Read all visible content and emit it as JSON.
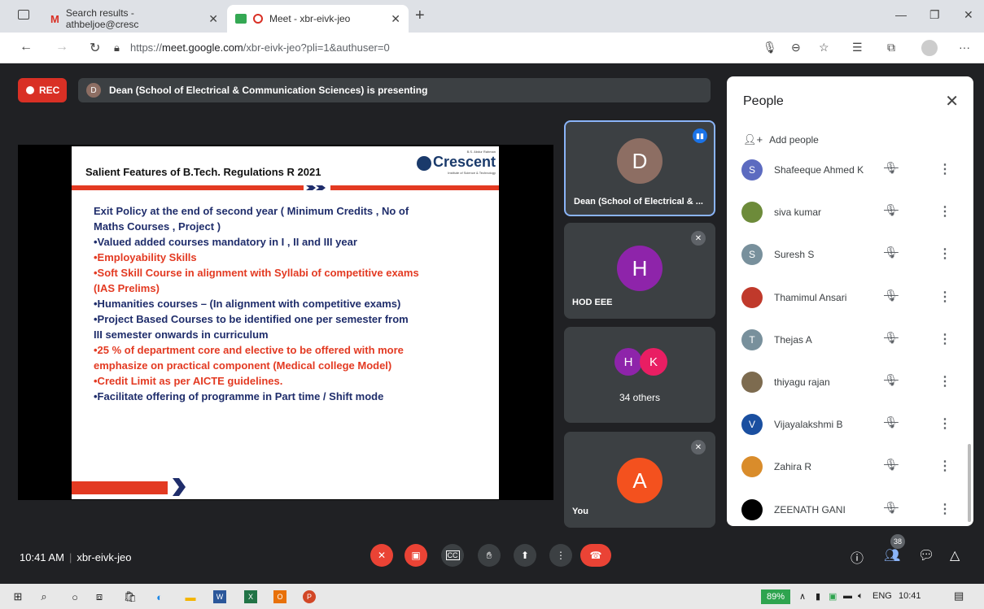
{
  "browser": {
    "tabs": [
      {
        "label": "Search results - athbeljoe@cresc",
        "icon": "gmail-icon"
      },
      {
        "label": "Meet - xbr-eivk-jeo",
        "icon": "meet-icon"
      }
    ],
    "url_prefix": "https://",
    "url_host": "meet.google.com",
    "url_path": "/xbr-eivk-jeo?pli=1&authuser=0"
  },
  "meet": {
    "rec_label": "REC",
    "presenting_avatar": "D",
    "presenting_text": "Dean (School of Electrical & Communication Sciences) is presenting",
    "meeting_time": "10:41 AM",
    "meeting_code": "xbr-eivk-jeo"
  },
  "slide": {
    "title": "Salient Features of B.Tech. Regulations R 2021",
    "logo_name": "Crescent",
    "logo_top": "B.S. Abdur Rahman",
    "logo_sub": "Institute of Science & Technology",
    "lines": [
      {
        "text": "Exit Policy at the end of second year ( Minimum Credits , No of",
        "color": "blue"
      },
      {
        "text": "Maths Courses , Project )",
        "color": "blue"
      },
      {
        "text": "•Valued added courses mandatory in I , II and III year",
        "color": "blue"
      },
      {
        "text": "•Employability Skills",
        "color": "red"
      },
      {
        "text": "•Soft Skill Course in alignment with Syllabi of competitive exams",
        "color": "red"
      },
      {
        "text": "(IAS Prelims)",
        "color": "red"
      },
      {
        "text": "•Humanities courses – (In alignment with competitive exams)",
        "color": "blue"
      },
      {
        "text": "•Project Based Courses to be identified one per semester from",
        "color": "blue"
      },
      {
        "text": "III semester onwards in curriculum",
        "color": "blue"
      },
      {
        "text": "•25 % of department core and elective to be offered with more",
        "color": "red"
      },
      {
        "text": "emphasize on practical component (Medical college Model)",
        "color": "red"
      },
      {
        "text": "•Credit Limit as per AICTE guidelines.",
        "color": "red"
      },
      {
        "text": "•Facilitate offering of programme in Part time / Shift mode",
        "color": "blue"
      }
    ]
  },
  "tiles": {
    "dean": {
      "initial": "D",
      "name": "Dean (School of Electrical & ...",
      "color": "#8d6e63"
    },
    "hod": {
      "initial": "H",
      "name": "HOD EEE",
      "color": "#8e24aa"
    },
    "others": {
      "initial1": "H",
      "initial2": "K",
      "label": "34 others",
      "color1": "#8e24aa",
      "color2": "#e91e63"
    },
    "you": {
      "initial": "A",
      "name": "You",
      "color": "#f4511e"
    }
  },
  "people_panel": {
    "title": "People",
    "add_people": "Add people",
    "participants": [
      {
        "name": "Shafeeque Ahmed K",
        "initial": "S",
        "color": "#5c6bc0"
      },
      {
        "name": "siva kumar",
        "initial": "",
        "color": "#6d8b3a"
      },
      {
        "name": "Suresh S",
        "initial": "S",
        "color": "#78909c"
      },
      {
        "name": "Thamimul Ansari",
        "initial": "",
        "color": "#c0392b"
      },
      {
        "name": "Thejas A",
        "initial": "T",
        "color": "#78909c"
      },
      {
        "name": "thiyagu rajan",
        "initial": "",
        "color": "#7d6b4f"
      },
      {
        "name": "Vijayalakshmi B",
        "initial": "V",
        "color": "#1a4fa0"
      },
      {
        "name": "Zahira R",
        "initial": "",
        "color": "#d98c2b"
      },
      {
        "name": "ZEENATH GANI",
        "initial": "",
        "color": "#000000"
      }
    ]
  },
  "controls": {
    "participant_count": "38"
  },
  "taskbar": {
    "battery": "89%",
    "lang": "ENG",
    "time": "10:41"
  }
}
